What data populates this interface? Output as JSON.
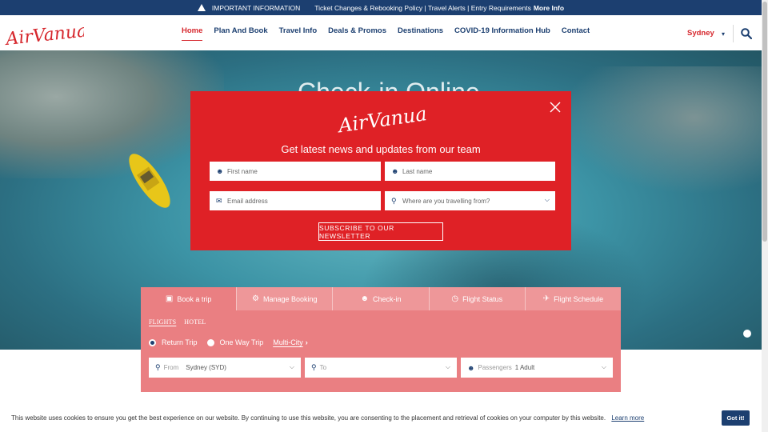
{
  "alert": {
    "icon": "warning-icon",
    "label": "IMPORTANT INFORMATION",
    "text": "Ticket Changes & Rebooking Policy | Travel Alerts | Entry Requirements",
    "more": "More Info"
  },
  "header": {
    "logo_text": "AirVanuatu",
    "nav": [
      "Home",
      "Plan And Book",
      "Travel Info",
      "Deals & Promos",
      "Destinations",
      "COVID-19 Information Hub",
      "Contact"
    ],
    "active_index": 0,
    "city": "Sydney",
    "search_icon": "search-icon"
  },
  "hero": {
    "title": "Check-in Online"
  },
  "newsletter": {
    "logo_text": "AirVanuatu",
    "heading": "Get latest news and updates from our team",
    "first_name_placeholder": "First name",
    "last_name_placeholder": "Last name",
    "email_placeholder": "Email address",
    "origin_placeholder": "Where are you travelling from?",
    "subscribe_label": "SUBSCRIBE TO OUR NEWSLETTER"
  },
  "booking": {
    "tabs": [
      {
        "label": "Book a trip",
        "icon": "briefcase-icon"
      },
      {
        "label": "Manage Booking",
        "icon": "gear-icon"
      },
      {
        "label": "Check-in",
        "icon": "user-check-icon"
      },
      {
        "label": "Flight Status",
        "icon": "clock-icon"
      },
      {
        "label": "Flight Schedule",
        "icon": "plane-icon"
      }
    ],
    "subtabs": [
      "FLIGHTS",
      "HOTEL"
    ],
    "trip_types": {
      "return": "Return Trip",
      "oneway": "One Way Trip",
      "multi": "Multi-City"
    },
    "selected_trip": "Return Trip",
    "from_label": "From",
    "from_value": "Sydney (SYD)",
    "to_label": "To",
    "passengers_label": "Passengers",
    "passengers_value": "1 Adult"
  },
  "cookie": {
    "text": "This website uses cookies to ensure you get the best experience on our website. By continuing to use this website, you are consenting to the placement and retrieval of cookies on your computer by this website.",
    "learn_more": "Learn more",
    "got_it": "Got it!"
  },
  "colors": {
    "brand_red": "#df2126",
    "navy": "#1c3f70",
    "booking_bg": "#ea7f82"
  }
}
